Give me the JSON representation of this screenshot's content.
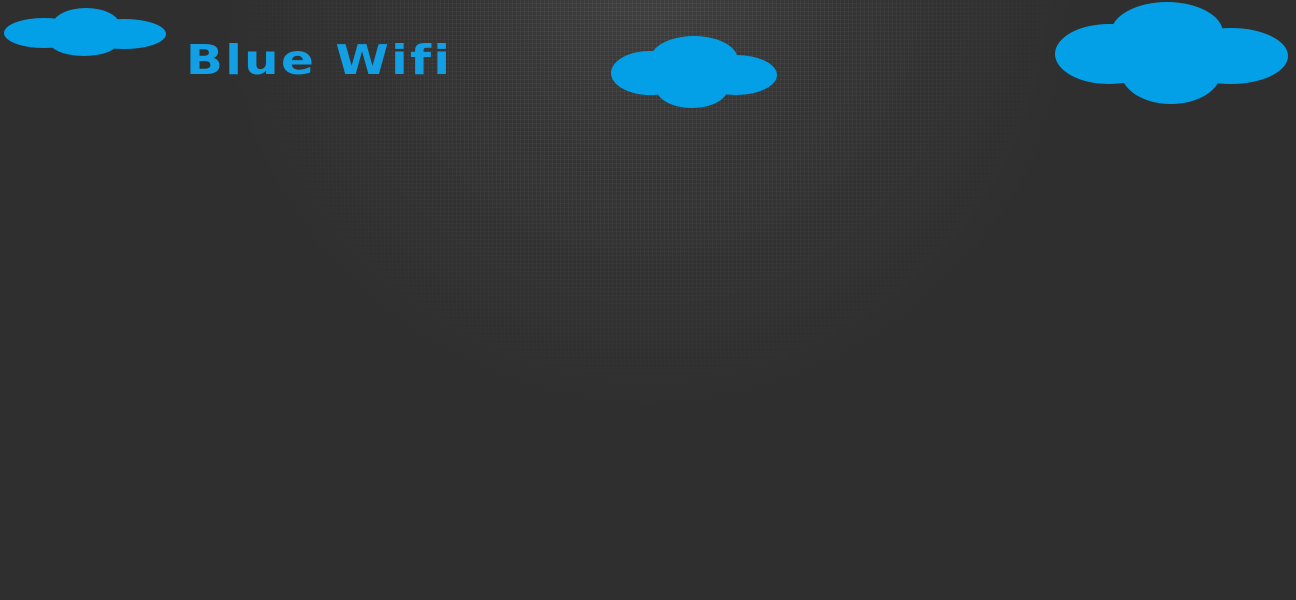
{
  "header": {
    "title": "Blue Wifi"
  },
  "decor": {
    "icon": "cloud-icon",
    "cloud_count": 3
  },
  "colors": {
    "brand": "#129fe3",
    "cloud": "#03a0e8",
    "background": "#2f2f2f"
  }
}
